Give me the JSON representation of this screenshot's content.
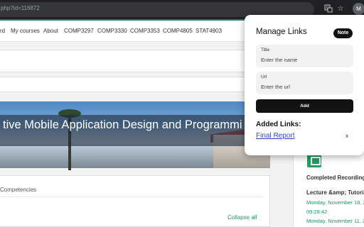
{
  "browser": {
    "url": "php?id=116872",
    "profile_initial": "M",
    "icons": [
      "translate-icon",
      "star-icon"
    ]
  },
  "nav": {
    "items": [
      "rd",
      "My courses",
      "About",
      "COMP3297",
      "COMP3330",
      "COMP3353",
      "COMP4805",
      "STAT4903"
    ]
  },
  "banner": {
    "title": "tive Mobile Application Design and Programmi"
  },
  "course": {
    "tab_label": "Competencies",
    "collapse_label": "Collapse all"
  },
  "sidebar": {
    "heading": "Completed Recordings",
    "entry_title": "Lecture &amp; Tutoria",
    "dates": [
      "Monday, November 18, 2",
      "09:28:42",
      "Monday, November 11, 2"
    ]
  },
  "popup": {
    "title": "Manage Links",
    "note_label": "Note",
    "title_field": {
      "label": "Title",
      "placeholder": "Enter the name"
    },
    "url_field": {
      "label": "Url",
      "placeholder": "Enter the url"
    },
    "add_label": "Add",
    "added_heading": "Added Links:",
    "links": [
      {
        "text": "Final Report",
        "remove": "x"
      }
    ]
  },
  "colors": {
    "accent": "#1f7f6d",
    "link": "#2d46d6",
    "popup_button": "#121212"
  }
}
